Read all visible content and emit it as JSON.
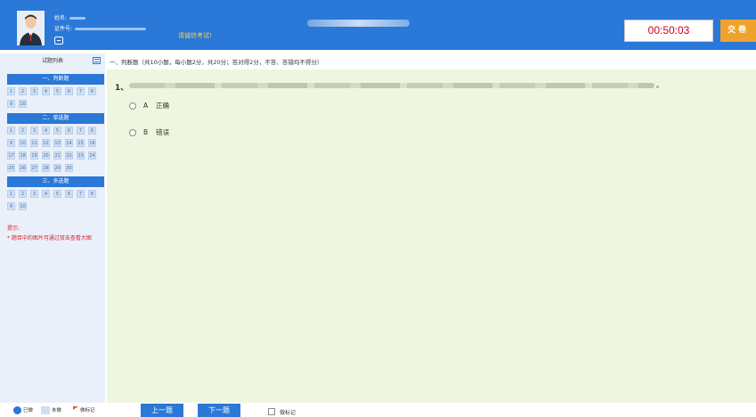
{
  "header": {
    "name_label": "姓名:",
    "id_label": "证件号:",
    "notice": "请诚信考试!",
    "timer": "00:50:03",
    "submit_label": "交卷"
  },
  "sidebar": {
    "title": "试题列表",
    "sections": [
      {
        "label": "一、判断题",
        "count": 10
      },
      {
        "label": "二、单选题",
        "count": 30
      },
      {
        "label": "三、多选题",
        "count": 10
      }
    ],
    "hint_title": "提示:",
    "hint_text": "* 题目中的图片可通过双击查看大图"
  },
  "question": {
    "section_header": "一、判断题（共10小题，每小题2分，共20分；答对得2分，不答、答错均不得分）",
    "number": "1、",
    "stem_end": "。",
    "options": [
      {
        "letter": "A",
        "text": "正确"
      },
      {
        "letter": "B",
        "text": "错误"
      }
    ]
  },
  "footer": {
    "legend_answered": "已做",
    "legend_unanswered": "未做",
    "legend_flagged": "做标记",
    "prev_label": "上一题",
    "next_label": "下一题",
    "mark_label": "做标记"
  },
  "colors": {
    "primary": "#2a78d8",
    "submit": "#f0a32b",
    "timer_text": "#d0021b",
    "main_bg": "#eef6df",
    "sidebar_bg": "#eaf0fa",
    "hint": "#e0202a"
  }
}
